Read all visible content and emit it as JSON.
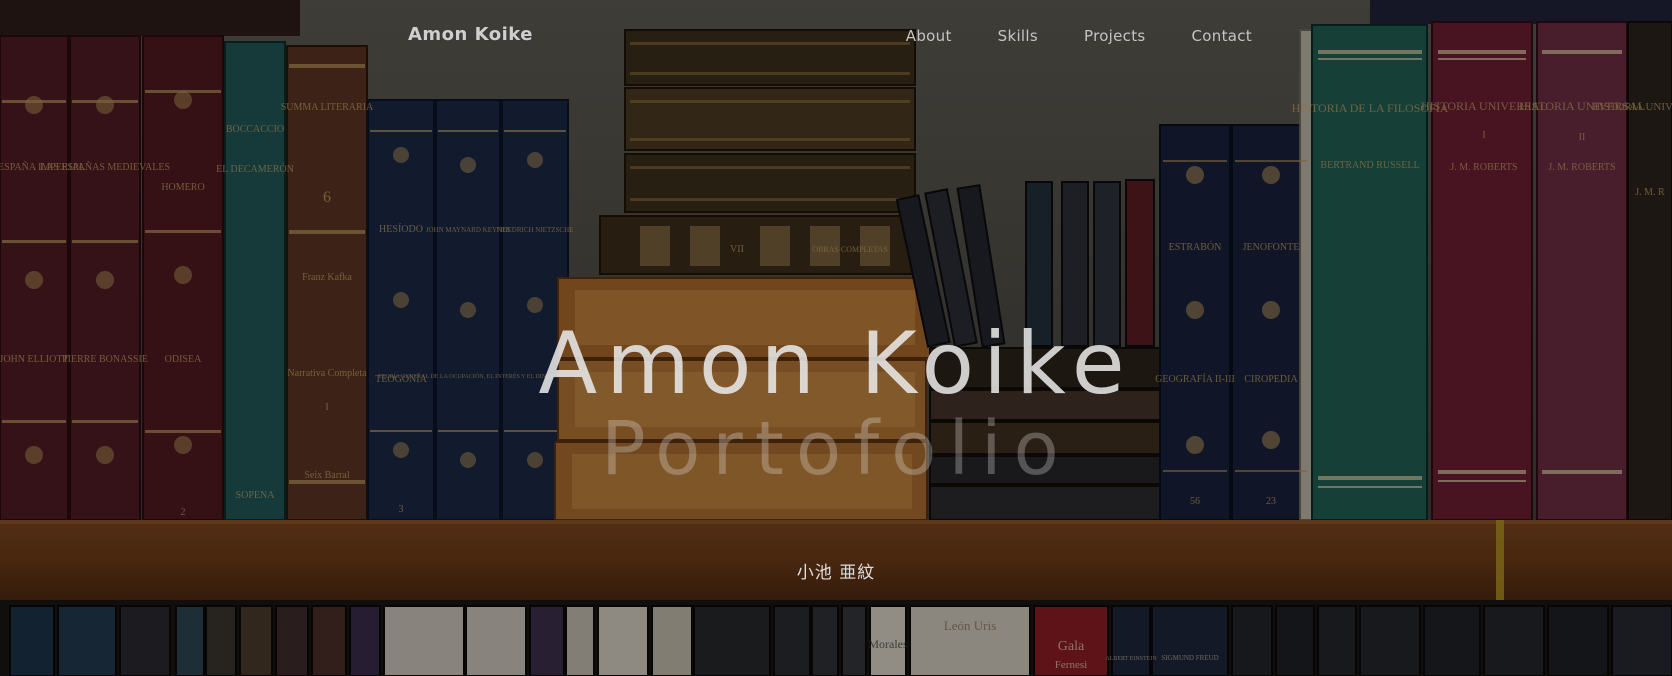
{
  "brand": "Amon Koike",
  "nav": {
    "about": "About",
    "skills": "Skills",
    "projects": "Projects",
    "contact": "Contact"
  },
  "hero": {
    "title": "Amon Koike",
    "subtitle": "Portofolio",
    "japanese_name": "小池 亜紋"
  },
  "books": {
    "b1": "LA ESPAÑA IMPERIAL",
    "b1b": "JOHN ELLIOTT",
    "b2": "LAS ESPAÑAS MEDIEVALES",
    "b2b": "PIERRE BONASSIE",
    "b3": "HOMERO",
    "b3b": "ODISEA",
    "b3c": "2",
    "b4": "BOCCACCIO",
    "b4b": "EL DECAMERÓN",
    "b4c": "SOPENA",
    "b5": "SUMMA LITERARIA",
    "b5b": "6",
    "b5c": "Franz Kafka",
    "b5d": "Narrativa Completa",
    "b5e": "I",
    "b5f": "Seix Barral",
    "b6": "HESÍODO",
    "b6b": "TEOGONÍA",
    "b6c": "3",
    "b7": "JOHN MAYNARD KEYNES",
    "b7b": "TEORÍA GENERAL DE LA OCUPACIÓN, EL INTERÉS Y EL DINERO",
    "b8": "FRIEDRICH NIETZSCHE",
    "b9": "ESTRABÓN",
    "b9b": "GEOGRAFÍA II-III",
    "b9c": "56",
    "b10": "JENOFONTE",
    "b10b": "CIROPEDIA",
    "b10c": "23",
    "b11": "HISTORIA DE LA FILOSOFÍA",
    "b11b": "BERTRAND RUSSELL",
    "b12": "HISTORIA UNIVERSAL",
    "b12b": "I",
    "b12c": "J. M. ROBERTS",
    "b13": "HISTORIA UNIVERSAL",
    "b13b": "II",
    "b13c": "J. M. ROBERTS",
    "b14": "HISTORIA UNIVERSAL",
    "b14b": "J. M. R",
    "c1": "VII",
    "c2": "OBRAS COMPLETAS",
    "l1": "León Uris",
    "l2": "Gala",
    "l3": "Fernesi",
    "l4": "Morales",
    "l5": "ALBERT EINSTEIN",
    "l6": "SIGMUND FREUD"
  },
  "colors": {
    "nav_text": "#c4c4c4",
    "shelf": "#6b3a17",
    "overlay": "rgba(0,0,0,0.32)"
  }
}
